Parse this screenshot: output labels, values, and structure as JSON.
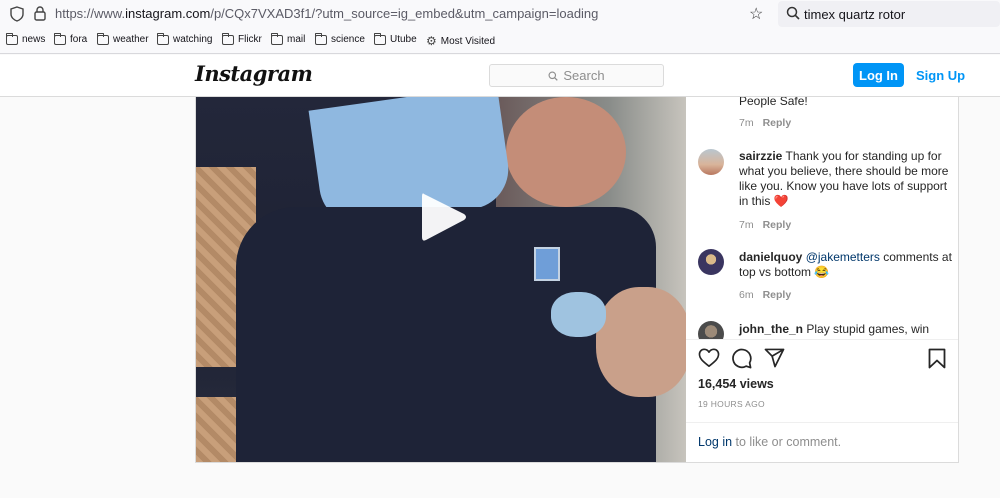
{
  "browser": {
    "url_prefix": "https://www.",
    "url_domain": "instagram.com",
    "url_suffix": "/p/CQx7VXAD3f1/?utm_source=ig_embed&utm_campaign=loading",
    "search_query": "timex quartz rotor",
    "bookmarks": [
      "news",
      "fora",
      "weather",
      "watching",
      "Flickr",
      "mail",
      "science",
      "Utube",
      "Most Visited"
    ]
  },
  "instagram": {
    "logo": "Instagram",
    "search_placeholder": "Search",
    "login_button": "Log In",
    "signup_link": "Sign Up"
  },
  "post": {
    "comments": [
      {
        "user": "",
        "text": "People Safe!",
        "age": "7m",
        "reply": "Reply"
      },
      {
        "user": "sairzzie",
        "text": "Thank you for standing up for what you believe, there should be more like you. Know you have lots of support in this ❤️",
        "age": "7m",
        "reply": "Reply"
      },
      {
        "user": "danielquoy",
        "mention": "@jakemetters",
        "text": " comments at top vs bottom 😂",
        "age": "6m",
        "reply": "Reply"
      },
      {
        "user": "john_the_n",
        "text": "Play stupid games, win"
      }
    ],
    "views": "16,454 views",
    "posted": "19 HOURS AGO",
    "login_link": "Log in",
    "login_rest": " to like or comment."
  },
  "colors": {
    "accent": "#0095f6",
    "link": "#00376b",
    "muted": "#8e8e8e"
  }
}
